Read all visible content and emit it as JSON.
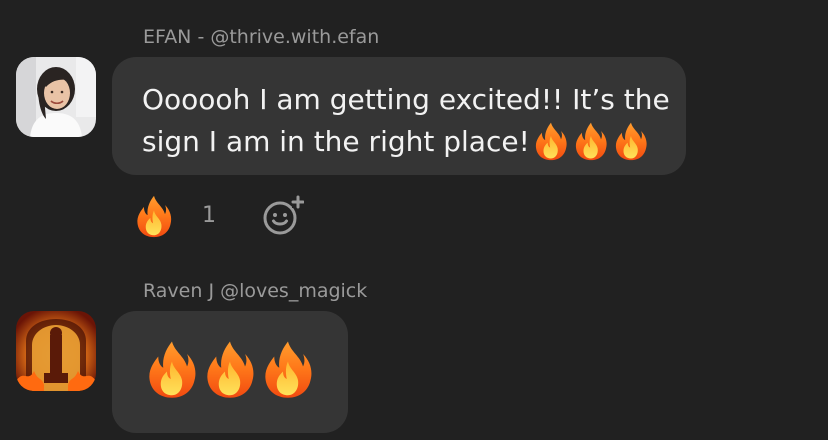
{
  "messages": [
    {
      "author": "EFAN - @thrive.with.efan",
      "avatar": "user-photo-avatar",
      "text": "Oooooh I am getting excited!! It’s the sign I am in the right place!",
      "inline_emoji": [
        "fire-emoji",
        "fire-emoji",
        "fire-emoji"
      ],
      "reaction": {
        "emoji": "fire-emoji",
        "count": "1"
      },
      "add_reaction_icon": "add-reaction-icon"
    },
    {
      "author": "Raven J @loves_magick",
      "avatar": "fire-temple-avatar",
      "emoji_only": [
        "fire-emoji",
        "fire-emoji",
        "fire-emoji"
      ]
    }
  ],
  "colors": {
    "background": "#212121",
    "bubble": "#353535",
    "text": "#f2f2f2",
    "muted": "#9a9a9a"
  }
}
